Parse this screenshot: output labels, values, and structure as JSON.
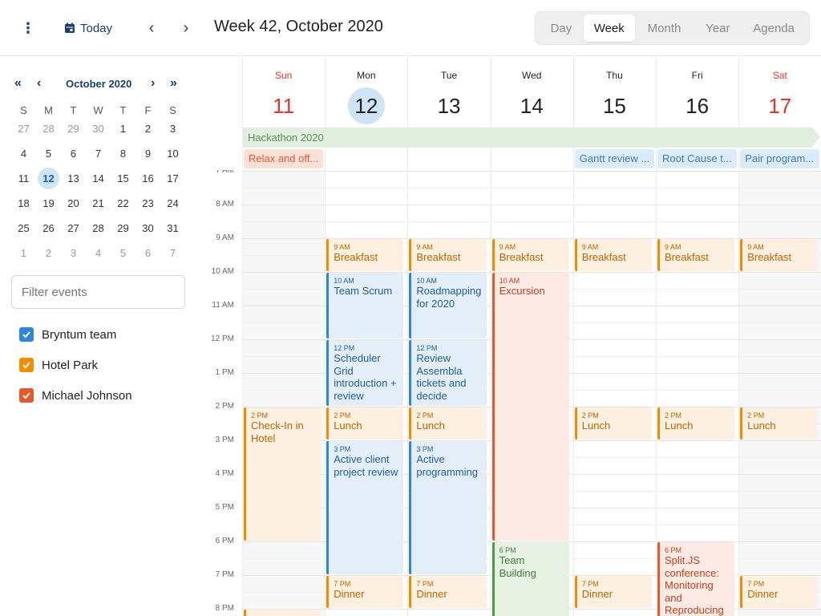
{
  "toolbar": {
    "menu_icon": "more-vertical-icon",
    "today_label": "Today",
    "title": "Week 42, October 2020",
    "views": [
      "Day",
      "Week",
      "Month",
      "Year",
      "Agenda"
    ],
    "active_view": "Week"
  },
  "mini_calendar": {
    "title": "October 2020",
    "dow": [
      "S",
      "M",
      "T",
      "W",
      "T",
      "F",
      "S"
    ],
    "weeks": [
      [
        "27",
        "28",
        "29",
        "30",
        "1",
        "2",
        "3"
      ],
      [
        "4",
        "5",
        "6",
        "7",
        "8",
        "9",
        "10"
      ],
      [
        "11",
        "12",
        "13",
        "14",
        "15",
        "16",
        "17"
      ],
      [
        "18",
        "19",
        "20",
        "21",
        "22",
        "23",
        "24"
      ],
      [
        "25",
        "26",
        "27",
        "28",
        "29",
        "30",
        "31"
      ],
      [
        "1",
        "2",
        "3",
        "4",
        "5",
        "6",
        "7"
      ]
    ],
    "selected": "12"
  },
  "filter": {
    "placeholder": "Filter events"
  },
  "resources": [
    {
      "name": "Bryntum team",
      "color": "#2f86d8",
      "checked": true
    },
    {
      "name": "Hotel Park",
      "color": "#f08c00",
      "checked": true
    },
    {
      "name": "Michael Johnson",
      "color": "#e05a2c",
      "checked": true
    }
  ],
  "days": [
    {
      "name": "Sun",
      "date": "11",
      "weekend": true
    },
    {
      "name": "Mon",
      "date": "12",
      "today": true
    },
    {
      "name": "Tue",
      "date": "13"
    },
    {
      "name": "Wed",
      "date": "14"
    },
    {
      "name": "Thu",
      "date": "15"
    },
    {
      "name": "Fri",
      "date": "16"
    },
    {
      "name": "Sat",
      "date": "17",
      "weekend": true
    }
  ],
  "all_day": {
    "hackathon": "Hackathon 2020",
    "events": [
      {
        "name": "Relax and off...",
        "day": 0,
        "color": "orange"
      },
      {
        "name": "Gantt review ...",
        "day": 4,
        "color": "blue"
      },
      {
        "name": "Root Cause t...",
        "day": 5,
        "color": "blue"
      },
      {
        "name": "Pair program...",
        "day": 6,
        "color": "blue"
      }
    ]
  },
  "time_labels": [
    "7 AM",
    "8 AM",
    "9 AM",
    "10 AM",
    "11 AM",
    "12 PM",
    "1 PM",
    "2 PM",
    "3 PM",
    "4 PM",
    "5 PM",
    "6 PM",
    "7 PM",
    "8 PM"
  ],
  "events": [
    {
      "day": 1,
      "start": 9,
      "end": 10,
      "time": "9 AM",
      "name": "Breakfast",
      "c": "o"
    },
    {
      "day": 2,
      "start": 9,
      "end": 10,
      "time": "9 AM",
      "name": "Breakfast",
      "c": "o"
    },
    {
      "day": 3,
      "start": 9,
      "end": 10,
      "time": "9 AM",
      "name": "Breakfast",
      "c": "o"
    },
    {
      "day": 4,
      "start": 9,
      "end": 10,
      "time": "9 AM",
      "name": "Breakfast",
      "c": "o"
    },
    {
      "day": 5,
      "start": 9,
      "end": 10,
      "time": "9 AM",
      "name": "Breakfast",
      "c": "o"
    },
    {
      "day": 6,
      "start": 9,
      "end": 10,
      "time": "9 AM",
      "name": "Breakfast",
      "c": "o"
    },
    {
      "day": 1,
      "start": 10,
      "end": 12,
      "time": "10 AM",
      "name": "Team Scrum",
      "c": "b"
    },
    {
      "day": 2,
      "start": 10,
      "end": 12,
      "time": "10 AM",
      "name": "Roadmapping for 2020",
      "c": "b"
    },
    {
      "day": 3,
      "start": 10,
      "end": 18,
      "time": "10 AM",
      "name": "Excursion",
      "c": "r"
    },
    {
      "day": 1,
      "start": 12,
      "end": 14,
      "time": "12 PM",
      "name": "Scheduler Grid introduction + review",
      "c": "b"
    },
    {
      "day": 2,
      "start": 12,
      "end": 14,
      "time": "12 PM",
      "name": "Review Assembla tickets and decide",
      "c": "b"
    },
    {
      "day": 0,
      "start": 14,
      "end": 18,
      "time": "2 PM",
      "name": "Check-In in Hotel",
      "c": "o"
    },
    {
      "day": 1,
      "start": 14,
      "end": 15,
      "time": "2 PM",
      "name": "Lunch",
      "c": "o"
    },
    {
      "day": 2,
      "start": 14,
      "end": 15,
      "time": "2 PM",
      "name": "Lunch",
      "c": "o"
    },
    {
      "day": 4,
      "start": 14,
      "end": 15,
      "time": "2 PM",
      "name": "Lunch",
      "c": "o"
    },
    {
      "day": 5,
      "start": 14,
      "end": 15,
      "time": "2 PM",
      "name": "Lunch",
      "c": "o"
    },
    {
      "day": 6,
      "start": 14,
      "end": 15,
      "time": "2 PM",
      "name": "Lunch",
      "c": "o"
    },
    {
      "day": 1,
      "start": 15,
      "end": 19,
      "time": "3 PM",
      "name": "Active client project review",
      "c": "b"
    },
    {
      "day": 2,
      "start": 15,
      "end": 19,
      "time": "3 PM",
      "name": "Active programming",
      "c": "b"
    },
    {
      "day": 3,
      "start": 18,
      "end": 21,
      "time": "6 PM",
      "name": "Team Building",
      "c": "g"
    },
    {
      "day": 5,
      "start": 18,
      "end": 21,
      "time": "6 PM",
      "name": "Split.JS conference: Monitoring and Reproducing Errors in Web",
      "c": "r"
    },
    {
      "day": 1,
      "start": 19,
      "end": 20,
      "time": "7 PM",
      "name": "Dinner",
      "c": "o"
    },
    {
      "day": 2,
      "start": 19,
      "end": 20,
      "time": "7 PM",
      "name": "Dinner",
      "c": "o"
    },
    {
      "day": 4,
      "start": 19,
      "end": 20,
      "time": "7 PM",
      "name": "Dinner",
      "c": "o"
    },
    {
      "day": 6,
      "start": 19,
      "end": 20,
      "time": "7 PM",
      "name": "Dinner",
      "c": "o"
    },
    {
      "day": 0,
      "start": 20,
      "end": 21,
      "time": "",
      "name": "",
      "c": "o"
    }
  ]
}
